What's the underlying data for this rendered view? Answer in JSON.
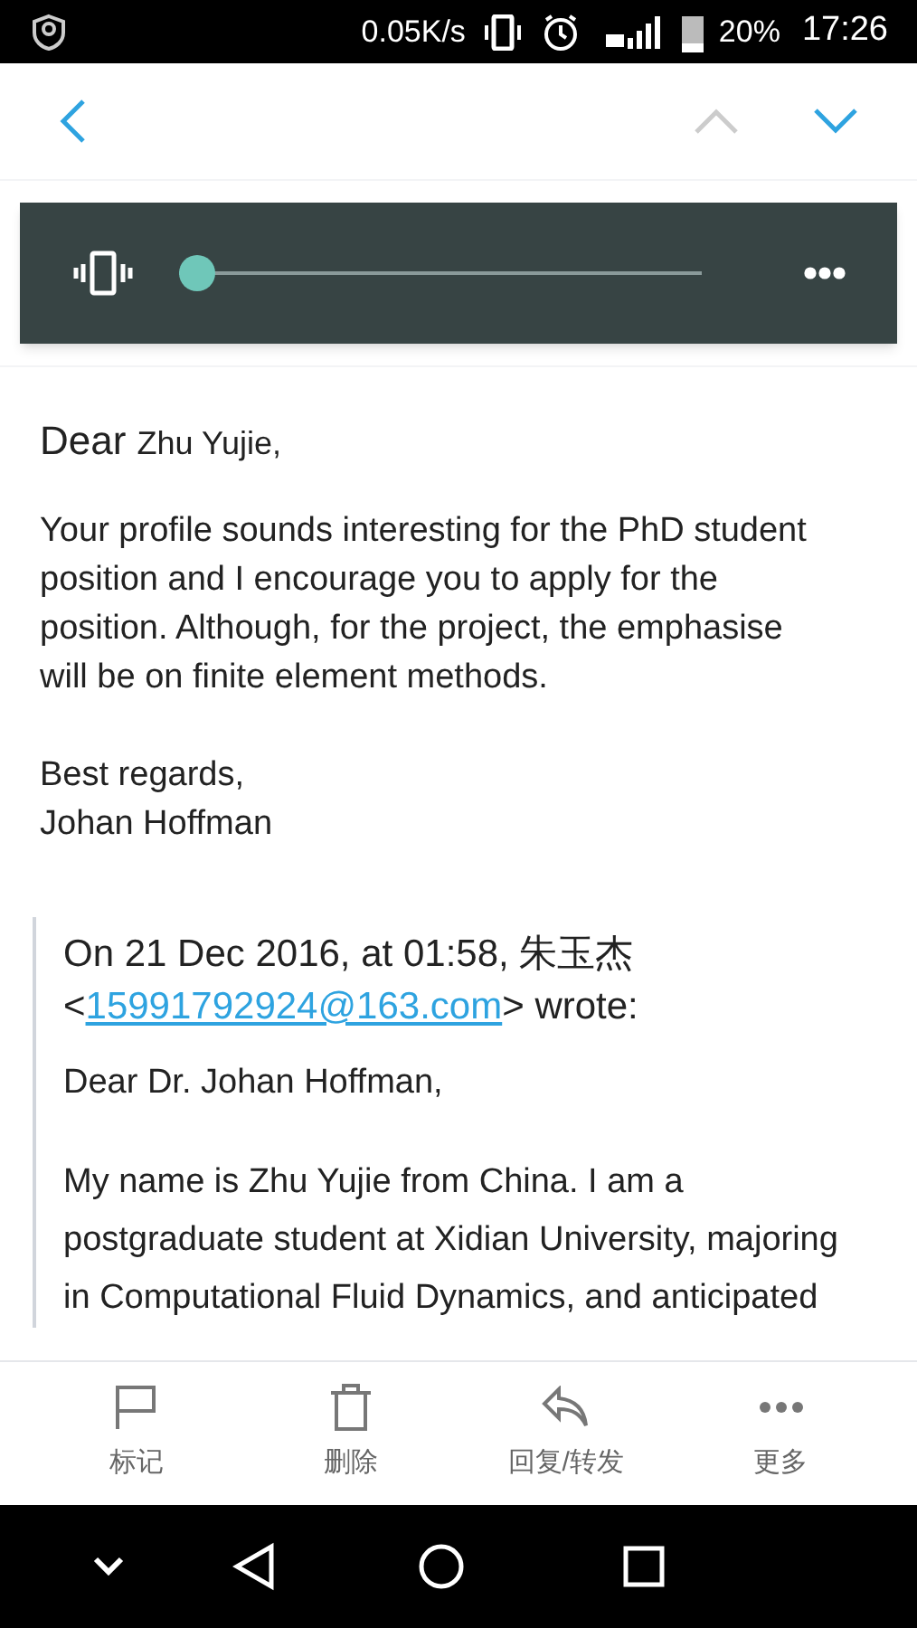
{
  "status_bar": {
    "speed": "0.05K/s",
    "battery": "20%",
    "time": "17:26"
  },
  "nav": {
    "up_disabled": true,
    "down_disabled": false
  },
  "player": {
    "level": 0
  },
  "message": {
    "greeting": "Dear",
    "name": "Zhu Yujie,",
    "paragraphs": [
      "Your profile sounds interesting for the PhD student position and I encourage you to apply for the position. Although, for the project, the emphasise will be on finite element methods."
    ],
    "closing": [
      "Best regards,",
      "Johan Hoffman"
    ]
  },
  "quote": {
    "header_before": "On 21 Dec 2016, at 01:58, 朱玉杰 <",
    "email": "15991792924@163.com",
    "header_after": "> wrote:",
    "paragraphs": [
      "Dear Dr. Johan Hoffman,",
      "My name is Zhu Yujie from China. I am a postgraduate student at Xidian University, majoring in Computational Fluid Dynamics, and anticipated"
    ]
  },
  "toolbar": [
    {
      "kind": "flag",
      "label": "标记"
    },
    {
      "kind": "trash",
      "label": "删除"
    },
    {
      "kind": "reply",
      "label": "回复/转发"
    },
    {
      "kind": "more",
      "label": "更多"
    }
  ]
}
